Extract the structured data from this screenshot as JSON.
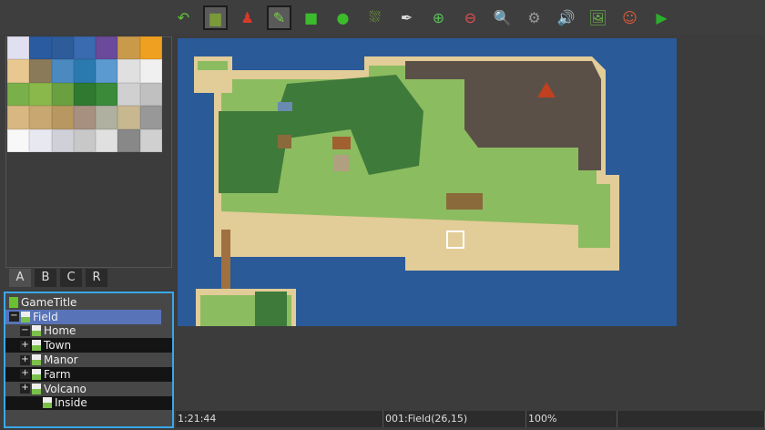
{
  "toolbar": {
    "buttons": [
      {
        "icon": "undo-icon",
        "glyph": "↶",
        "color": "#5fc43a"
      },
      {
        "icon": "map-layer-icon",
        "glyph": "▆",
        "color": "#7a9a3a",
        "active": true
      },
      {
        "icon": "event-layer-icon",
        "glyph": "♟",
        "color": "#d83a2a"
      },
      {
        "icon": "pencil-icon",
        "glyph": "✎",
        "color": "#7ad04a",
        "active": true
      },
      {
        "icon": "rectangle-icon",
        "glyph": "■",
        "color": "#3cbc2c"
      },
      {
        "icon": "ellipse-icon",
        "glyph": "●",
        "color": "#3cbc2c"
      },
      {
        "icon": "fill-icon",
        "glyph": "⛆",
        "color": "#8ac83a"
      },
      {
        "icon": "shadow-pen-icon",
        "glyph": "✒",
        "color": "#ddd"
      },
      {
        "icon": "zoom-in-icon",
        "glyph": "⊕",
        "color": "#5ac05a"
      },
      {
        "icon": "zoom-out-icon",
        "glyph": "⊖",
        "color": "#e05050"
      },
      {
        "icon": "zoom-actual-icon",
        "glyph": "🔍",
        "color": "#ddd"
      },
      {
        "icon": "gear-icon",
        "glyph": "⚙",
        "color": "#999"
      },
      {
        "icon": "sound-icon",
        "glyph": "🔊",
        "color": "#f0b020"
      },
      {
        "icon": "resource-manager-icon",
        "glyph": "🖼",
        "color": "#6ab04a"
      },
      {
        "icon": "character-generator-icon",
        "glyph": "☺",
        "color": "#e05a3a"
      },
      {
        "icon": "playtest-icon",
        "glyph": "▶",
        "color": "#2ab02a"
      }
    ]
  },
  "tileset_tabs": [
    "A",
    "B",
    "C",
    "R"
  ],
  "tileset_colors": [
    "#e0e0f0",
    "#2a5aa0",
    "#2e5c9a",
    "#3a6ab0",
    "#6a4a9a",
    "#c89a4a",
    "#f0a020",
    "#e8c890",
    "#8a7a5a",
    "#4a8ac0",
    "#2a7ab0",
    "#5a9ad0",
    "#e0e0e0",
    "#f0f0f0",
    "#7ab04a",
    "#8ab84a",
    "#6aa040",
    "#2e7a30",
    "#3a8a3a",
    "#d0d0d0",
    "#c0c0c0",
    "#d8b880",
    "#c8a870",
    "#b89860",
    "#a89080",
    "#b0b0a0",
    "#c8b890",
    "#989898",
    "#f8f8f8",
    "#e8e8f0",
    "#d0d0d8",
    "#c8c8c8",
    "#e0e0e0",
    "#888888",
    "#d0d0d0"
  ],
  "map_tree": [
    {
      "label": "GameTitle",
      "level": 0,
      "toggle": "",
      "root": true
    },
    {
      "label": "Field",
      "level": 0,
      "toggle": "−",
      "selected": true
    },
    {
      "label": "Home",
      "level": 1,
      "toggle": "−"
    },
    {
      "label": "Town",
      "level": 1,
      "toggle": "+"
    },
    {
      "label": "Manor",
      "level": 1,
      "toggle": "+"
    },
    {
      "label": "Farm",
      "level": 1,
      "toggle": "+"
    },
    {
      "label": "Volcano",
      "level": 1,
      "toggle": "+"
    },
    {
      "label": "Inside",
      "level": 2,
      "toggle": ""
    }
  ],
  "colors": {
    "ocean": "#2a5a98",
    "sand": "#e2cc98",
    "grass": "#8cbc60",
    "forest": "#3e7a3a",
    "rock": "#5a5048",
    "selection": "#5873b8",
    "tree_border": "#3aa7e8"
  },
  "status": {
    "time": "1:21:44",
    "map": "001:Field(26,15)",
    "zoom": "100%"
  }
}
